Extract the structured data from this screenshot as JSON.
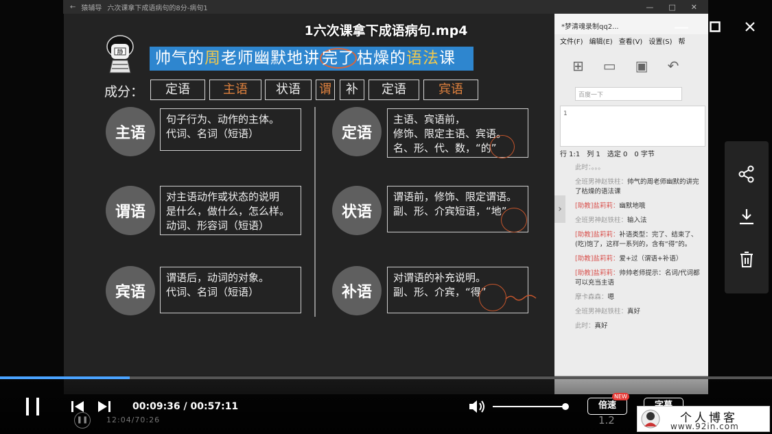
{
  "player": {
    "video_title": "1六次课拿下成语病句.mp4",
    "current_time": "00:09:36",
    "duration": "00:57:11",
    "time_separator": "/",
    "progress": 0.168,
    "volume": 0.98,
    "speed_label": "倍速",
    "speed_badge": "NEW",
    "subtitle_label": "字幕"
  },
  "recorded_window": {
    "app_name": "猿辅导",
    "window_title": "六次课拿下成语病句的8分-病句1",
    "underlying_time": "12:04/70:26",
    "underlying_speed": "1.2"
  },
  "slide": {
    "mascot_text": "静",
    "title_parts": [
      {
        "text": "帅气的",
        "hl": false
      },
      {
        "text": "周",
        "hl": true
      },
      {
        "text": "老师幽默地讲",
        "hl": false
      },
      {
        "text": "完了",
        "hl": false,
        "circled": true
      },
      {
        "text": "枯燥的",
        "hl": false
      },
      {
        "text": "语法",
        "hl": true
      },
      {
        "text": "课",
        "hl": false
      }
    ],
    "chengfen_label": "成分：",
    "components": [
      {
        "text": "定语",
        "orange": false
      },
      {
        "text": "主语",
        "orange": true
      },
      {
        "text": "状语",
        "orange": false
      },
      {
        "text": "谓",
        "orange": true
      },
      {
        "text": "补",
        "orange": false
      },
      {
        "text": "定语",
        "orange": false
      },
      {
        "text": "宾语",
        "orange": true
      }
    ],
    "items": [
      {
        "label": "主语",
        "desc": "句子行为、动作的主体。\n代词、名词（短语）"
      },
      {
        "label": "谓语",
        "desc": "对主语动作或状态的说明\n是什么，做什么，怎么样。\n动词、形容词（短语）"
      },
      {
        "label": "宾语",
        "desc": "谓语后，动词的对象。\n代词、名词（短语）"
      },
      {
        "label": "定语",
        "desc": "主语、宾语前，\n修饰、限定主语、宾语。\n名、形、代、数，“的”"
      },
      {
        "label": "状语",
        "desc": "谓语前，修饰、限定谓语。\n副、形、介宾短语，“地”"
      },
      {
        "label": "补语",
        "desc": "对谓语的补充说明。\n副、形、介宾，“得”"
      }
    ]
  },
  "side_panel": {
    "title": "*梦清魂录制qq2...",
    "menu": [
      "文件(F)",
      "编辑(E)",
      "查看(V)",
      "设置(S)",
      "帮"
    ],
    "search_placeholder": "百度一下",
    "line_number": "1",
    "status": [
      "行 1:1",
      "列 1",
      "选定 0",
      "0 字节"
    ],
    "chat": [
      {
        "name": "此时：。。。",
        "red": false,
        "text": ""
      },
      {
        "name": "全班男神赵铁柱：",
        "red": false,
        "text": "帅气的周老师幽默的讲完了枯燥的语法课"
      },
      {
        "name": "[助教]盐莉莉：",
        "red": true,
        "text": "幽默地哦"
      },
      {
        "name": "全班男神赵铁柱：",
        "red": false,
        "text": "输入法"
      },
      {
        "name": "[助教]盐莉莉：",
        "red": true,
        "text": "补语类型：完了、结束了、(吃)饱了，这样一系列的，含有“得”的。"
      },
      {
        "name": "[助教]盐莉莉：",
        "red": true,
        "text": "爱+过（谓语+补语）"
      },
      {
        "name": "[助教]盐莉莉：",
        "red": true,
        "text": "帅帅老师提示：名词/代词都可以充当主语"
      },
      {
        "name": "摩卡森森：",
        "red": false,
        "text": "嗯"
      },
      {
        "name": "全班男神赵铁柱：",
        "red": false,
        "text": "真好"
      },
      {
        "name": "此时：",
        "red": false,
        "text": "真好"
      }
    ]
  },
  "watermark": {
    "title": "个人博客",
    "url": "www.92in.com"
  },
  "colors": {
    "accent_blue": "#2e86cf",
    "highlight_yellow": "#f2c94c",
    "orange": "#e0823e",
    "progress": "#4aa3ff"
  }
}
